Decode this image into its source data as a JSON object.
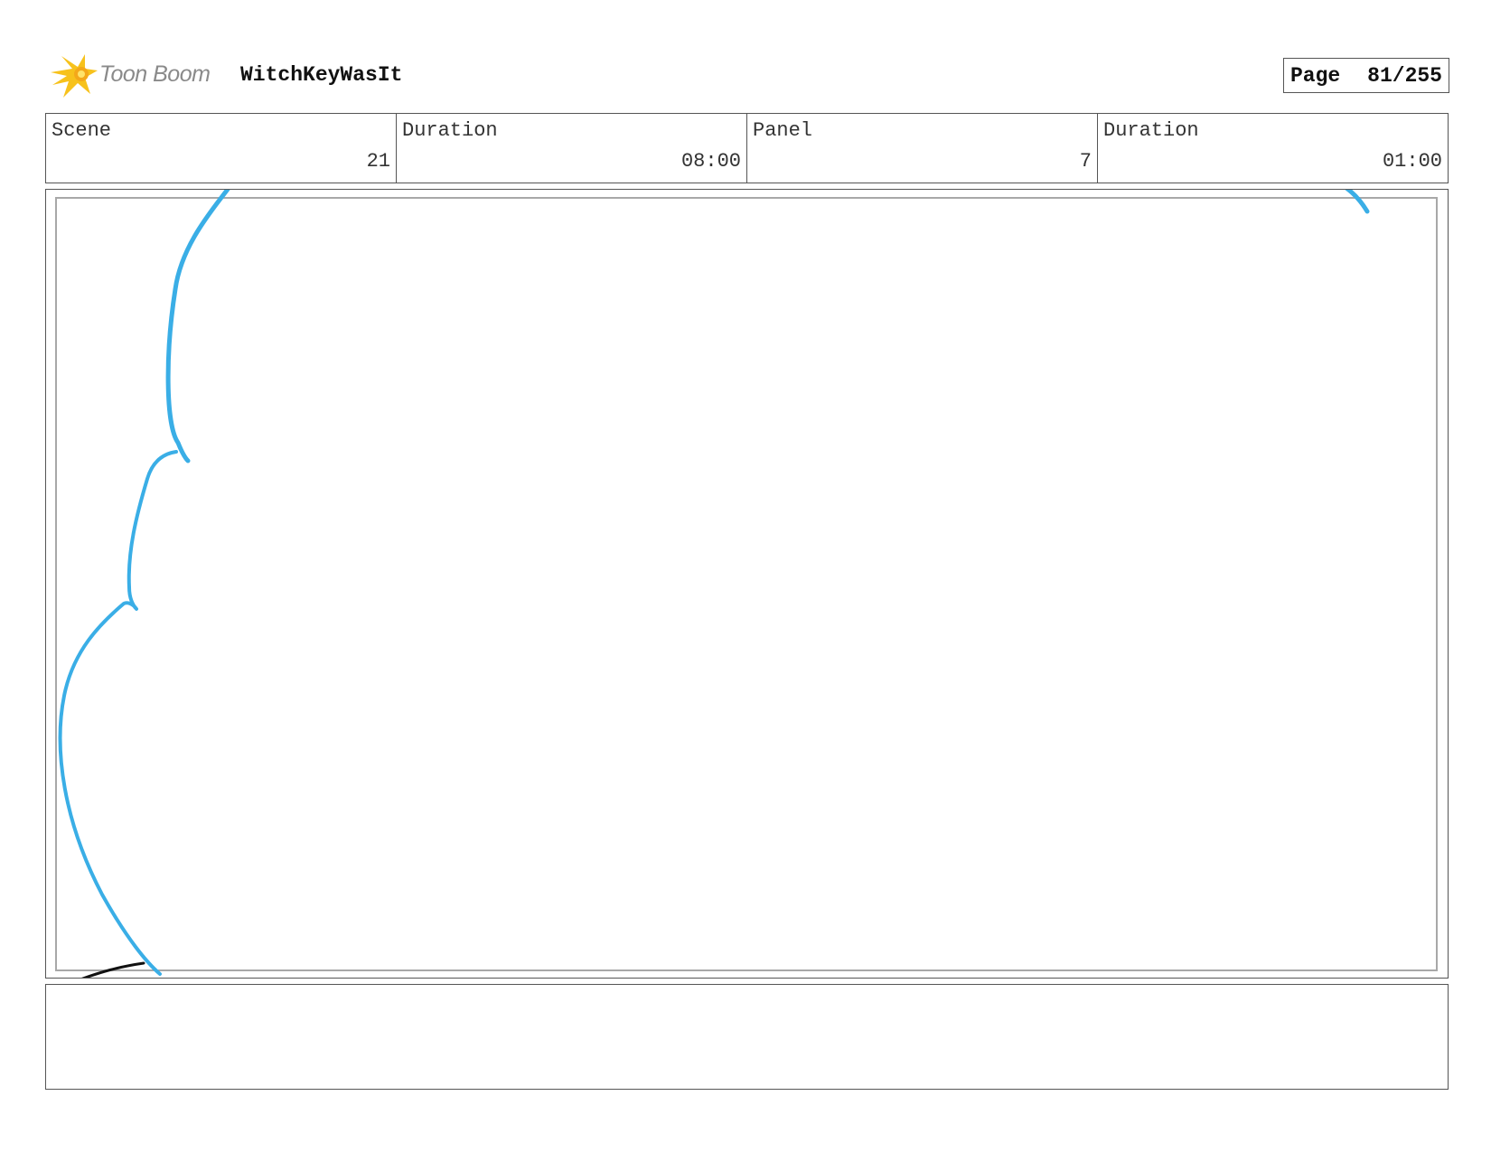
{
  "header": {
    "logo_icon": "toon-boom-starburst-icon",
    "logo_text": "Toon Boom",
    "project_title": "WitchKeyWasIt",
    "page_label": "Page",
    "page_number": "81/255"
  },
  "info": {
    "cells": [
      {
        "label": "Scene",
        "value": "21"
      },
      {
        "label": "Duration",
        "value": "08:00"
      },
      {
        "label": "Panel",
        "value": "7"
      },
      {
        "label": "Duration",
        "value": "01:00"
      }
    ]
  },
  "panel": {
    "sketch_color": "#3aaee6",
    "ink_color": "#111111"
  },
  "caption": {
    "text": ""
  }
}
